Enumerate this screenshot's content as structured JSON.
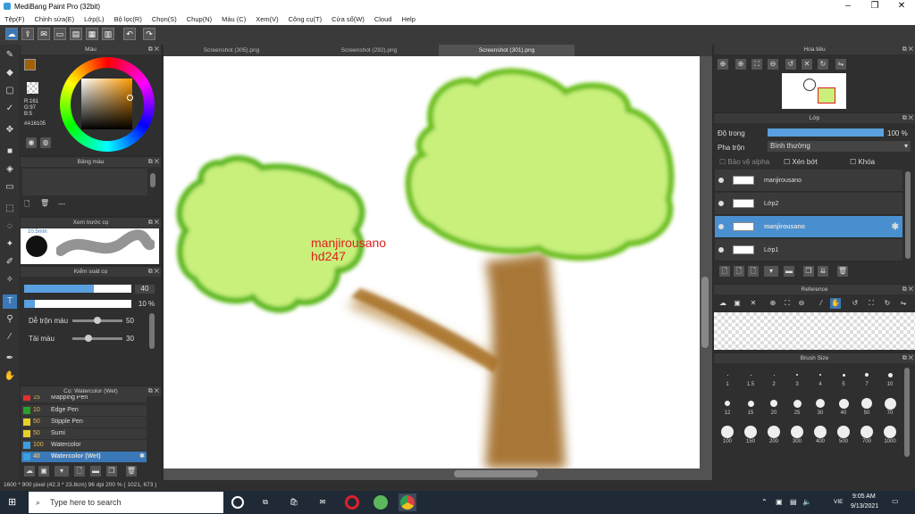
{
  "window": {
    "title": "MediBang Paint Pro (32bit)"
  },
  "menu": [
    "Tệp(F)",
    "Chỉnh sửa(E)",
    "Lớp(L)",
    "Bộ lọc(R)",
    "Chọn(S)",
    "Chụp(N)",
    "Màu (C)",
    "Xem(V)",
    "Công cụ(T)",
    "Cửa sổ(W)",
    "Cloud",
    "Help"
  ],
  "tabs": [
    "Screenshot (305).png",
    "Screenshot (292).png",
    "Screenshot (301).png"
  ],
  "color_panel": {
    "title": "Màu",
    "r": "R:161",
    "g": "G:97",
    "b": "B:5",
    "hex": "#A16105",
    "fg": "#a16105",
    "bg": "#ffffff"
  },
  "palette_panel": {
    "title": "Bảng màu",
    "value": "---"
  },
  "brush_preview": {
    "title": "Xem trước cọ",
    "size": "10.5mm"
  },
  "brush_control": {
    "title": "Kiểm soát cọ",
    "size_value": "40",
    "opacity_value": "10 %",
    "blend_label": "Dễ trộn màu",
    "blend_value": "50",
    "reload_label": "Tải màu",
    "reload_value": "30",
    "size_fill": 0.65,
    "opacity_fill": 0.1
  },
  "brush_list": {
    "title": "Cọ: Watercolor (Wet)",
    "items": [
      {
        "num": "15",
        "name": "Mapping Pen",
        "color": "#e03030"
      },
      {
        "num": "10",
        "name": "Edge Pen",
        "color": "#2aa02a"
      },
      {
        "num": "50",
        "name": "Stipple Pen",
        "color": "#e8d02a"
      },
      {
        "num": "50",
        "name": "Sumi",
        "color": "#e8d02a"
      },
      {
        "num": "100",
        "name": "Watercolor",
        "color": "#3aa0e0"
      },
      {
        "num": "40",
        "name": "Watercolor (Wet)",
        "color": "#3aa0e0"
      }
    ]
  },
  "navigator": {
    "title": "Hoa tiêu"
  },
  "layer_panel": {
    "title": "Lớp",
    "opacity_label": "Độ trong",
    "opacity_value": "100 %",
    "blend_label": "Pha trộn",
    "blend_value": "Bình thường",
    "protect_alpha": "Bảo vệ alpha",
    "clipping": "Xén bớt",
    "lock": "Khóa",
    "layers": [
      "manjirousano",
      "Lớp2",
      "manjirousano",
      "Lớp1"
    ]
  },
  "reference_panel": {
    "title": "Reference"
  },
  "brush_size_panel": {
    "title": "Brush Size",
    "row1": [
      "1",
      "1.5",
      "2",
      "3",
      "4",
      "5",
      "7",
      "10"
    ],
    "row2": [
      "12",
      "15",
      "20",
      "25",
      "30",
      "40",
      "50",
      "70"
    ],
    "row3": [
      "100",
      "150",
      "200",
      "300",
      "400",
      "500",
      "700",
      "1000"
    ]
  },
  "canvas_text": {
    "line1": "manjirousano",
    "line2": "hd247"
  },
  "statusbar": "1600 * 900 pixel  (42.3 * 23.8cm)  96 dpi  200 %  ( 1021, 673 )",
  "taskbar": {
    "search_placeholder": "Type here to search",
    "time": "9:05 AM",
    "date": "9/13/2021",
    "lang": "VIE"
  }
}
